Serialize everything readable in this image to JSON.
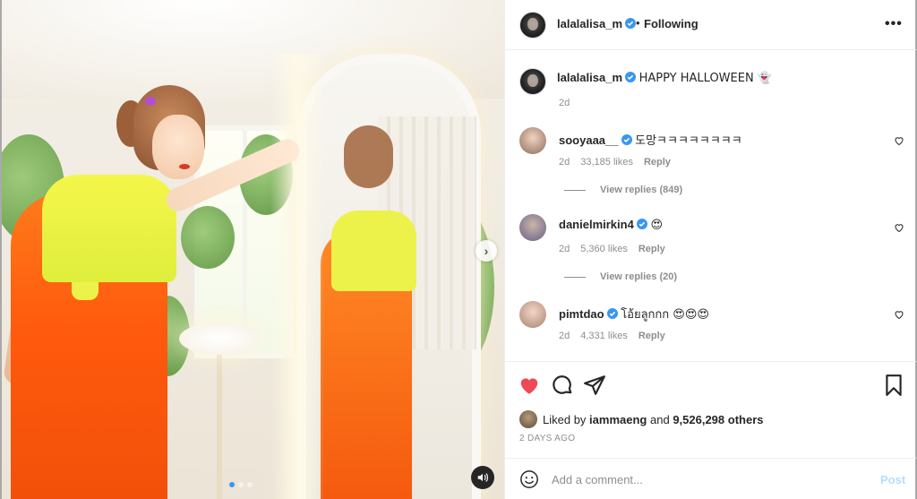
{
  "post": {
    "username": "lalalalisa_m",
    "separator": "•",
    "follow_status": "Following",
    "more_glyph": "•••",
    "caption": "HAPPY HALLOWEEN 👻",
    "caption_time": "2d"
  },
  "media": {
    "next_glyph": "›",
    "carousel_dots": 3,
    "active_dot": 0
  },
  "comments": [
    {
      "username": "sooyaaa__",
      "text": "도망ㅋㅋㅋㅋㅋㅋㅋㅋ",
      "time": "2d",
      "likes": "33,185 likes",
      "reply": "Reply",
      "view_replies": "View replies (849)"
    },
    {
      "username": "danielmirkin4",
      "text": "😍",
      "time": "2d",
      "likes": "5,360 likes",
      "reply": "Reply",
      "view_replies": "View replies (20)"
    },
    {
      "username": "pimtdao",
      "text": "โอ้ยลูกกก 😍😍😍",
      "time": "2d",
      "likes": "4,331 likes",
      "reply": "Reply"
    }
  ],
  "liked_by": {
    "prefix": "Liked by",
    "user": "iammaeng",
    "middle": "and",
    "count": "9,526,298 others"
  },
  "date": "2 DAYS AGO",
  "comment_box": {
    "placeholder": "Add a comment...",
    "post_label": "Post"
  },
  "colors": {
    "verified": "#3897f0",
    "like": "#ed4956",
    "text": "#262626",
    "muted": "#8e8e8e",
    "post_disabled": "#b2dffc"
  },
  "icons": [
    "heart-filled-icon",
    "comment-icon",
    "share-icon",
    "bookmark-icon",
    "emoji-icon",
    "sound-icon",
    "more-icon",
    "verified-icon",
    "chevron-right-icon"
  ]
}
